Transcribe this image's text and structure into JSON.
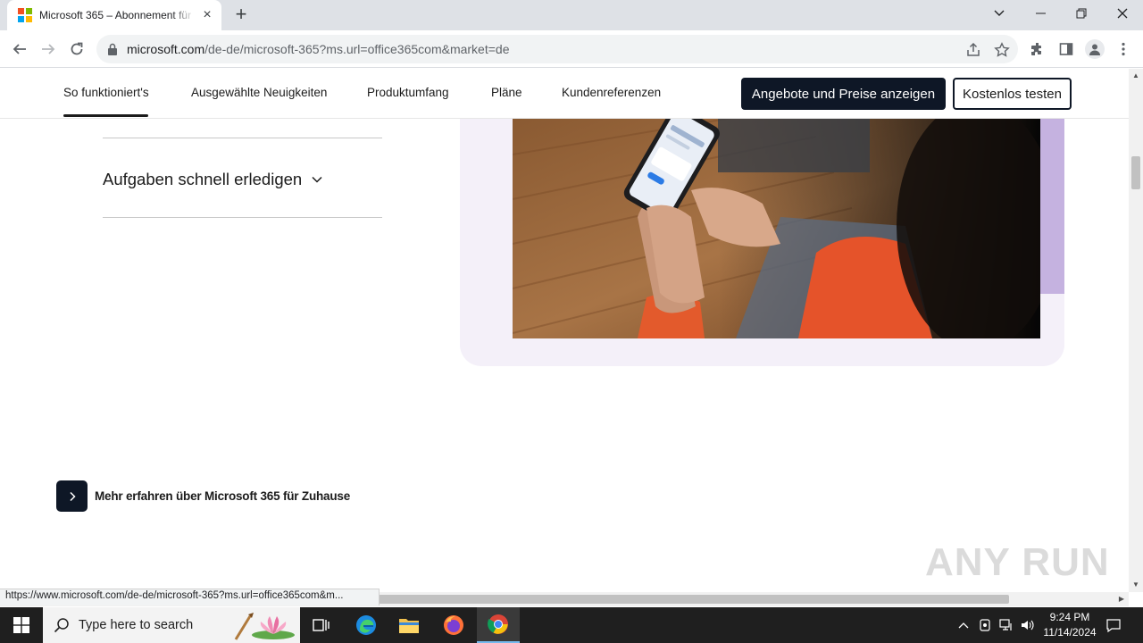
{
  "browser": {
    "tab_title": "Microsoft 365 – Abonnement für",
    "url_host": "microsoft.com",
    "url_path": "/de-de/microsoft-365?ms.url=office365com&market=de"
  },
  "subnav": {
    "items": [
      "So funktioniert's",
      "Ausgewählte Neuigkeiten",
      "Produktumfang",
      "Pläne",
      "Kundenreferenzen"
    ],
    "active_index": 0,
    "primary_cta": "Angebote und Preise anzeigen",
    "secondary_cta": "Kostenlos testen"
  },
  "content": {
    "accordion_label": "Aufgaben schnell erledigen",
    "learn_more": "Mehr erfahren über Microsoft 365 für Zuhause"
  },
  "status_url": "https://www.microsoft.com/de-de/microsoft-365?ms.url=office365com&m...",
  "watermark": "ANY RUN",
  "taskbar": {
    "search_placeholder": "Type here to search",
    "time": "9:24 PM",
    "date": "11/14/2024"
  },
  "colors": {
    "brand_dark": "#0e1726",
    "card_bg": "#f4f0f9",
    "accent_lavender": "#c5b2e0"
  }
}
